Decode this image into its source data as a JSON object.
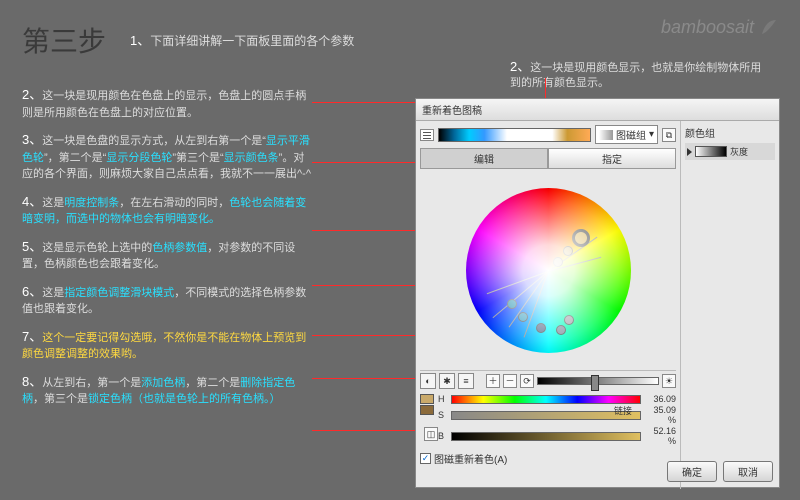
{
  "title": "第三步",
  "watermark": "bamboosait",
  "intro_num": "1、",
  "intro_text": "下面详细讲解一下面板里面的各个参数",
  "top_note_num": "2、",
  "top_note_text": "这一块是现用颜色显示，也就是你绘制物体所用到的所有颜色显示。",
  "notes": [
    {
      "n": "2、",
      "pre": "这一块是现用颜色在色盘上的显示，色盘上的圆点手柄则是所用颜色在色盘上的对应位置。"
    },
    {
      "n": "3、",
      "pre": "这一块是色盘的显示方式，从左到右第一个是“",
      "b1": "显示平滑色轮",
      "mid1": "”，第二个是“",
      "b2": "显示分段色轮",
      "mid2": "”第三个是“",
      "b3": "显示颜色条",
      "post": "”。对应的各个界面，则麻烦大家自己点点看，我就不一一展出^-^"
    },
    {
      "n": "4、",
      "pre": "这是",
      "b1": "明度控制条",
      "mid1": "，在左右滑动的同时，",
      "b2": "色轮也会随着变暗变明，而选中的物体也会有明暗变化。"
    },
    {
      "n": "5、",
      "pre": "这是显示色轮上选中的",
      "b1": "色柄参数值",
      "post": "，对参数的不同设置，色柄颜色也会跟着变化。"
    },
    {
      "n": "6、",
      "pre": "这是",
      "b1": "指定颜色调整滑块模式",
      "post": "，不同模式的选择色柄参数值也跟着变化。"
    },
    {
      "n": "7、",
      "y": "这个一定要记得勾选哦，不然你是不能在物体上预览到颜色调整调整的效果哟。"
    },
    {
      "n": "8、",
      "pre": "从左到右，第一个是",
      "b1": "添加色柄",
      "mid1": "，第二个是",
      "b2": "删除指定色柄",
      "mid2": "，第三个是",
      "b3": "锁定色柄（也就是色轮上的所有色柄。）"
    }
  ],
  "panel": {
    "title": "重新着色图稿",
    "preset_label": "图磁组",
    "tabs": {
      "edit": "编辑",
      "assign": "指定"
    },
    "group_title": "颜色组",
    "group_item": "灰度",
    "hsb": {
      "h": "H",
      "s": "S",
      "b": "B",
      "hv": "36.09",
      "sv": "35.09",
      "bv": "52.16",
      "unit": "%"
    },
    "recolor_chk": "图磁重新着色(A)",
    "link_label": "链接",
    "ok": "确定",
    "cancel": "取消"
  }
}
